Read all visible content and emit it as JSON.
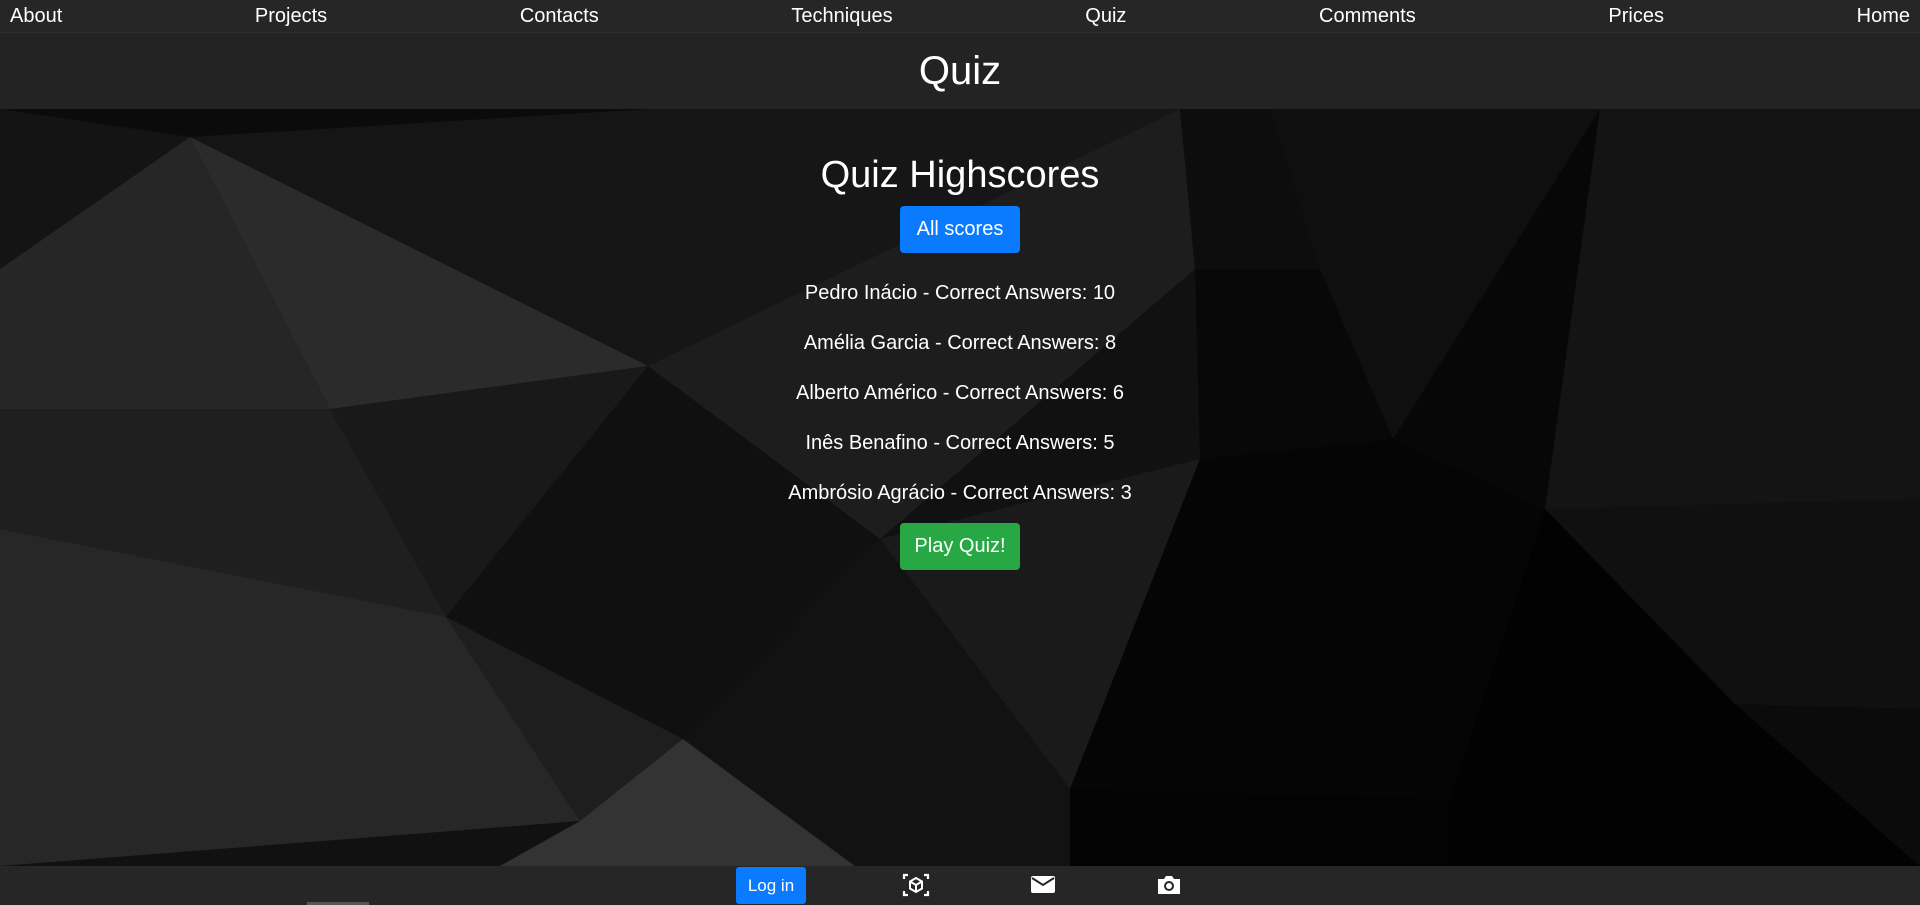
{
  "nav": {
    "items": [
      {
        "label": "About"
      },
      {
        "label": "Projects"
      },
      {
        "label": "Contacts"
      },
      {
        "label": "Techniques"
      },
      {
        "label": "Quiz"
      },
      {
        "label": "Comments"
      },
      {
        "label": "Prices"
      },
      {
        "label": "Home"
      }
    ]
  },
  "header": {
    "title": "Quiz"
  },
  "main": {
    "heading": "Quiz Highscores",
    "all_scores_label": "All scores",
    "scores": [
      {
        "text": "Pedro Inácio - Correct Answers: 10"
      },
      {
        "text": "Amélia Garcia - Correct Answers: 8"
      },
      {
        "text": "Alberto Américo - Correct Answers: 6"
      },
      {
        "text": "Inês Benafino - Correct Answers: 5"
      },
      {
        "text": "Ambrósio Agrácio - Correct Answers: 3"
      }
    ],
    "play_label": "Play Quiz!"
  },
  "footer": {
    "login_label": "Log in",
    "icons": [
      "3d-cube-icon",
      "mail-icon",
      "camera-icon"
    ]
  },
  "colors": {
    "primary": "#0a7bff",
    "success": "#27a844",
    "bar": "#262626"
  }
}
